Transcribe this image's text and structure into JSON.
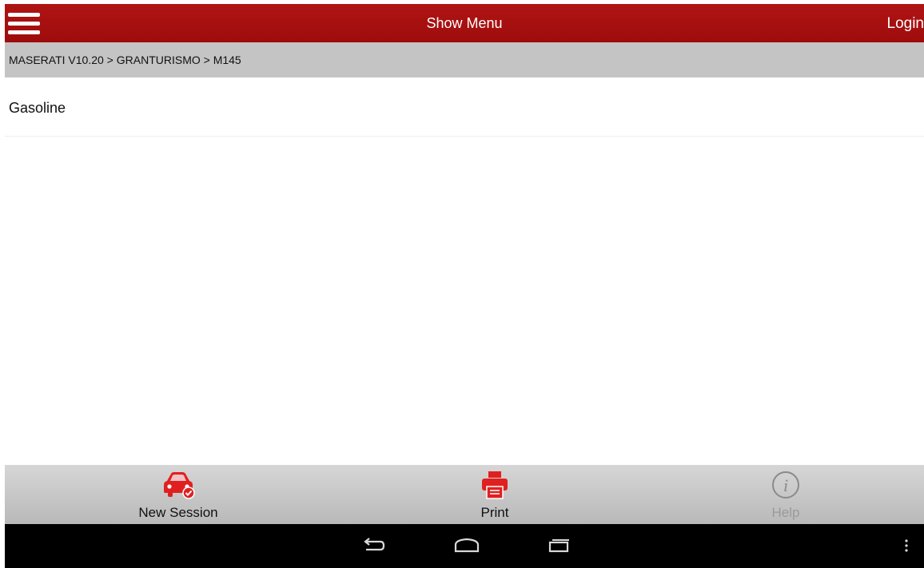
{
  "header": {
    "menu_icon": "hamburger-menu-icon",
    "title": "Show Menu",
    "login_label": "Login",
    "background_color": "#a50f0f"
  },
  "breadcrumb": {
    "path": "MASERATI V10.20 > GRANTURISMO > M145"
  },
  "list": {
    "items": [
      {
        "label": "Gasoline"
      }
    ]
  },
  "toolbar": {
    "items": [
      {
        "label": "New Session",
        "icon": "car-check-icon",
        "enabled": true
      },
      {
        "label": "Print",
        "icon": "printer-icon",
        "enabled": true
      },
      {
        "label": "Help",
        "icon": "info-circle-icon",
        "enabled": false
      }
    ],
    "accent_color": "#e02020"
  },
  "system_nav": {
    "buttons": [
      "back-icon",
      "home-icon",
      "recent-apps-icon",
      "overflow-menu-icon"
    ]
  }
}
